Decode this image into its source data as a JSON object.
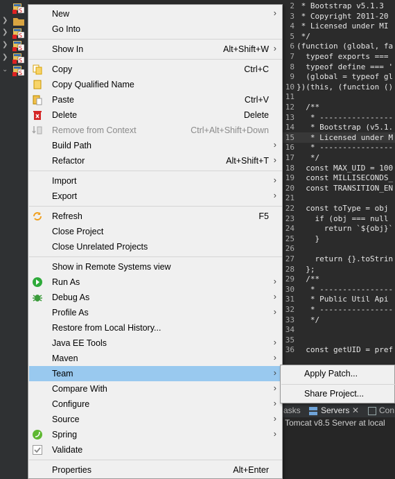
{
  "context_menu": {
    "items": [
      {
        "label": "New",
        "shortcut": "",
        "submenu": true,
        "icon": "",
        "disabled": false
      },
      {
        "label": "Go Into",
        "shortcut": "",
        "submenu": false,
        "icon": "",
        "disabled": false
      },
      {
        "label": "Show In",
        "shortcut": "Alt+Shift+W",
        "submenu": true,
        "icon": "",
        "disabled": false
      },
      {
        "label": "Copy",
        "shortcut": "Ctrl+C",
        "submenu": false,
        "icon": "copy-icon",
        "disabled": false
      },
      {
        "label": "Copy Qualified Name",
        "shortcut": "",
        "submenu": false,
        "icon": "copy-qualified-icon",
        "disabled": false
      },
      {
        "label": "Paste",
        "shortcut": "Ctrl+V",
        "submenu": false,
        "icon": "paste-icon",
        "disabled": false
      },
      {
        "label": "Delete",
        "shortcut": "Delete",
        "submenu": false,
        "icon": "delete-icon",
        "disabled": false
      },
      {
        "label": "Remove from Context",
        "shortcut": "Ctrl+Alt+Shift+Down",
        "submenu": false,
        "icon": "remove-context-icon",
        "disabled": true
      },
      {
        "label": "Build Path",
        "shortcut": "",
        "submenu": true,
        "icon": "",
        "disabled": false
      },
      {
        "label": "Refactor",
        "shortcut": "Alt+Shift+T",
        "submenu": true,
        "icon": "",
        "disabled": false
      },
      {
        "label": "Import",
        "shortcut": "",
        "submenu": true,
        "icon": "",
        "disabled": false
      },
      {
        "label": "Export",
        "shortcut": "",
        "submenu": true,
        "icon": "",
        "disabled": false
      },
      {
        "label": "Refresh",
        "shortcut": "F5",
        "submenu": false,
        "icon": "refresh-icon",
        "disabled": false
      },
      {
        "label": "Close Project",
        "shortcut": "",
        "submenu": false,
        "icon": "",
        "disabled": false
      },
      {
        "label": "Close Unrelated Projects",
        "shortcut": "",
        "submenu": false,
        "icon": "",
        "disabled": false
      },
      {
        "label": "Show in Remote Systems view",
        "shortcut": "",
        "submenu": false,
        "icon": "",
        "disabled": false
      },
      {
        "label": "Run As",
        "shortcut": "",
        "submenu": true,
        "icon": "run-icon",
        "disabled": false
      },
      {
        "label": "Debug As",
        "shortcut": "",
        "submenu": true,
        "icon": "bug-icon",
        "disabled": false
      },
      {
        "label": "Profile As",
        "shortcut": "",
        "submenu": true,
        "icon": "",
        "disabled": false
      },
      {
        "label": "Restore from Local History...",
        "shortcut": "",
        "submenu": false,
        "icon": "",
        "disabled": false
      },
      {
        "label": "Java EE Tools",
        "shortcut": "",
        "submenu": true,
        "icon": "",
        "disabled": false
      },
      {
        "label": "Maven",
        "shortcut": "",
        "submenu": true,
        "icon": "",
        "disabled": false
      },
      {
        "label": "Team",
        "shortcut": "",
        "submenu": true,
        "icon": "",
        "disabled": false,
        "selected": true
      },
      {
        "label": "Compare With",
        "shortcut": "",
        "submenu": true,
        "icon": "",
        "disabled": false
      },
      {
        "label": "Configure",
        "shortcut": "",
        "submenu": true,
        "icon": "",
        "disabled": false
      },
      {
        "label": "Source",
        "shortcut": "",
        "submenu": true,
        "icon": "",
        "disabled": false
      },
      {
        "label": "Spring",
        "shortcut": "",
        "submenu": true,
        "icon": "spring-icon",
        "disabled": false
      },
      {
        "label": "Validate",
        "shortcut": "",
        "submenu": false,
        "icon": "validate-icon",
        "disabled": false
      },
      {
        "label": "Properties",
        "shortcut": "Alt+Enter",
        "submenu": false,
        "icon": "",
        "disabled": false
      }
    ]
  },
  "team_submenu": {
    "items": [
      {
        "label": "Apply Patch..."
      },
      {
        "label": "Share Project..."
      }
    ]
  },
  "editor": {
    "lines": [
      {
        "num": "2",
        "text": " * Bootstrap v5.1.3"
      },
      {
        "num": "3",
        "text": " * Copyright 2011-20"
      },
      {
        "num": "4",
        "text": " * Licensed under MI"
      },
      {
        "num": "5",
        "text": " */"
      },
      {
        "num": "6",
        "text": "(function (global, fa"
      },
      {
        "num": "7",
        "text": "  typeof exports ==="
      },
      {
        "num": "8",
        "text": "  typeof define === '"
      },
      {
        "num": "9",
        "text": "  (global = typeof gl"
      },
      {
        "num": "10",
        "text": "})(this, (function ()"
      },
      {
        "num": "11",
        "text": ""
      },
      {
        "num": "12",
        "text": "  /**"
      },
      {
        "num": "13",
        "text": "   * ----------------"
      },
      {
        "num": "14",
        "text": "   * Bootstrap (v5.1."
      },
      {
        "num": "15",
        "text": "   * Licensed under M"
      },
      {
        "num": "16",
        "text": "   * ----------------"
      },
      {
        "num": "17",
        "text": "   */"
      },
      {
        "num": "18",
        "text": "  const MAX_UID = 100"
      },
      {
        "num": "19",
        "text": "  const MILLISECONDS_"
      },
      {
        "num": "20",
        "text": "  const TRANSITION_EN"
      },
      {
        "num": "21",
        "text": ""
      },
      {
        "num": "22",
        "text": "  const toType = obj"
      },
      {
        "num": "23",
        "text": "    if (obj === null"
      },
      {
        "num": "24",
        "text": "      return `${obj}`"
      },
      {
        "num": "25",
        "text": "    }"
      },
      {
        "num": "26",
        "text": ""
      },
      {
        "num": "27",
        "text": "    return {}.toStrin"
      },
      {
        "num": "28",
        "text": "  };"
      },
      {
        "num": "29",
        "text": "  /**"
      },
      {
        "num": "30",
        "text": "   * ----------------"
      },
      {
        "num": "31",
        "text": "   * Public Util Api"
      },
      {
        "num": "32",
        "text": "   * ----------------"
      },
      {
        "num": "33",
        "text": "   */"
      },
      {
        "num": "34",
        "text": ""
      },
      {
        "num": "35",
        "text": ""
      },
      {
        "num": "36",
        "text": "  const getUID = pref"
      }
    ],
    "highlighted_line": "15"
  },
  "bottom_views": {
    "tabs": [
      {
        "label": "asks"
      },
      {
        "label": "Servers"
      },
      {
        "label": "Con"
      }
    ],
    "server_entry": "Tomcat v8.5 Server at local"
  },
  "colors": {
    "menu_bg": "#f0f0f0",
    "selection": "#99c9ef",
    "editor_bg": "#2b2b2b"
  }
}
